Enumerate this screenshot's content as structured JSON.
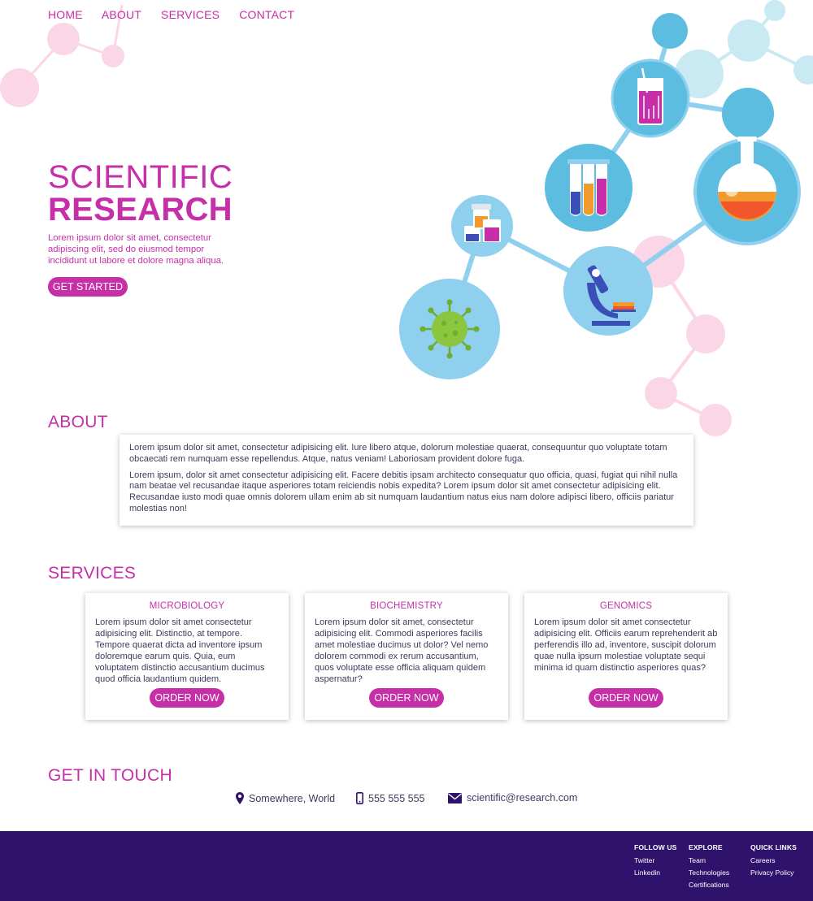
{
  "nav": {
    "home": "HOME",
    "about": "ABOUT",
    "services": "SERVICES",
    "contact": "CONTACT"
  },
  "hero": {
    "title_line1": "SCIENTIFIC",
    "title_line2": "RESEARCH",
    "description": "Lorem ipsum dolor sit amet, consectetur adipiscing elit, sed do eiusmod tempor incididunt ut labore et dolore magna aliqua.",
    "cta": "GET STARTED"
  },
  "about": {
    "heading": "ABOUT",
    "paragraphs": [
      "Lorem ipsum dolor sit amet, consectetur adipisicing elit. Iure libero atque, dolorum molestiae quaerat, consequuntur quo voluptate totam obcaecati rem numquam esse repellendus. Atque, natus veniam! Laboriosam provident dolore fuga.",
      "Lorem ipsum, dolor sit amet consectetur adipisicing elit. Facere debitis ipsam architecto consequatur quo officia, quasi, fugiat qui nihil nulla nam beatae vel recusandae itaque asperiores totam reiciendis nobis expedita? Lorem ipsum dolor sit amet consectetur adipisicing elit. Recusandae iusto modi quae omnis dolorem ullam enim ab sit numquam laudantium natus eius nam dolore adipisci libero, officiis pariatur molestias non!"
    ]
  },
  "services": {
    "heading": "SERVICES",
    "cards": [
      {
        "title": "MICROBIOLOGY",
        "text": "Lorem ipsum dolor sit amet consectetur adipisicing elit. Distinctio, at tempore. Tempore quaerat dicta ad inventore ipsum doloremque earum quis. Quia, eum voluptatem distinctio accusantium ducimus quod officia laudantium quidem.",
        "button": "ORDER NOW"
      },
      {
        "title": "BIOCHEMISTRY",
        "text": "Lorem ipsum dolor sit amet, consectetur adipisicing elit. Commodi asperiores facilis amet molestiae ducimus ut dolor? Vel nemo dolorem commodi ex rerum accusantium, quos voluptate esse officia aliquam quidem aspernatur?",
        "button": "ORDER NOW"
      },
      {
        "title": "GENOMICS",
        "text": "Lorem ipsum dolor sit amet consectetur adipisicing elit. Officiis earum reprehenderit ab perferendis illo ad, inventore, suscipit dolorum quae nulla ipsum molestiae voluptate sequi minima id quam distinctio asperiores quas?",
        "button": "ORDER NOW"
      }
    ]
  },
  "contact": {
    "heading": "GET IN TOUCH",
    "location": "Somewhere, World",
    "phone": "555 555 555",
    "email": "scientific@research.com",
    "icons": [
      "map-pin-icon",
      "phone-icon",
      "envelope-icon"
    ]
  },
  "footer": {
    "follow": {
      "heading": "FOLLOW US",
      "links": [
        "Twitter",
        "Linkedin"
      ]
    },
    "explore": {
      "heading": "EXPLORE",
      "links": [
        "Team",
        "Technologies",
        "Certifications"
      ]
    },
    "quick": {
      "heading": "QUICK LINKS",
      "links": [
        "Careers",
        "Privacy Policy"
      ]
    }
  },
  "colors": {
    "accent": "#c72fa8",
    "footer_bg": "#2e126b",
    "text": "#3e3a5e",
    "bubble_blue": "#8fd0ee",
    "molecule_pink": "#fbd6e6"
  }
}
